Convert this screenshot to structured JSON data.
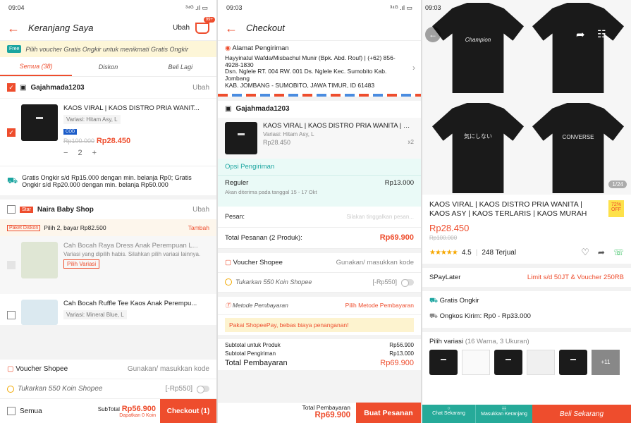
{
  "cart_screen": {
    "status_time": "09:04",
    "status_right": "³⁴ᴳ .ıl ▭",
    "title": "Keranjang Saya",
    "edit": "Ubah",
    "cart_badge": "99+",
    "notice": {
      "badge": "Free",
      "text": "Pilih voucher Gratis Ongkir untuk menikmati Gratis Ongkir"
    },
    "tabs": [
      "Semua (38)",
      "Diskon",
      "Beli Lagi"
    ],
    "shop1": {
      "name": "Gajahmada1203",
      "edit": "Ubah"
    },
    "item1": {
      "name": "KAOS VIRAL | KAOS DISTRO PRIA WANIT...",
      "variant": "Variasi: Hitam Asy, L",
      "tag": "COD",
      "old_price": "Rp100.000",
      "price": "Rp28.450",
      "minus": "−",
      "qty": "2",
      "plus": "+"
    },
    "shipping_note": "Gratis Ongkir s/d Rp15.000 dengan min. belanja Rp0; Gratis Ongkir s/d Rp20.000 dengan min. belanja Rp50.000",
    "shop2": {
      "badge": "Star",
      "name": "Naira Baby Shop",
      "edit": "Ubah"
    },
    "package": {
      "badge": "Paket Diskon",
      "text": "Pilih 2, bayar Rp82.500",
      "action": "Tambah"
    },
    "item2": {
      "name": "Cah Bocah Raya Dress Anak Perempuan L...",
      "note": "Variasi yang dipilih habis. Silahkan pilih variasi lainnya.",
      "button": "Pilih Variasi"
    },
    "item3": {
      "name": "Cah Bocah Ruffle Tee Kaos Anak Perempu...",
      "variant": "Variasi: Mineral Blue, L"
    },
    "voucher": {
      "label": "Voucher Shopee",
      "action": "Gunakan/ masukkan kode"
    },
    "coins": {
      "label": "Tukarkan 550 Koin Shopee",
      "value": "[-Rp550]"
    },
    "footer": {
      "all": "Semua",
      "subtotal_label": "SubTotal",
      "subtotal": "Rp56.900",
      "coins_earned": "Dapatkan 0 Koin",
      "checkout": "Checkout (1)"
    }
  },
  "checkout_screen": {
    "status_time": "09:03",
    "title": "Checkout",
    "address_label": "Alamat Pengiriman",
    "address_lines": [
      "Hayyinatul Wafda/Misbachul Munir (Bpk. Abd. Rouf) | (+62) 856-4928-1830",
      "Dsn. Nglele RT. 004 RW. 001 Ds. Nglele Kec. Sumobito Kab. Jombang",
      "KAB. JOMBANG - SUMOBITO, JAWA TIMUR, ID 61483"
    ],
    "shop": "Gajahmada1203",
    "product": {
      "name": "KAOS VIRAL | KAOS DISTRO PRIA WANITA | KA...",
      "variant": "Variasi: Hitam Asy, L",
      "price": "Rp28.450",
      "qty": "x2"
    },
    "shipping_options": "Opsi Pengiriman",
    "regular": {
      "label": "Reguler",
      "price": "Rp13.000",
      "eta": "Akan diterima pada tanggal 15 - 17 Okt"
    },
    "message": {
      "label": "Pesan:",
      "placeholder": "Silakan tinggalkan pesan..."
    },
    "order_total": {
      "label": "Total Pesanan (2 Produk):",
      "value": "Rp69.900"
    },
    "voucher": {
      "label": "Voucher Shopee",
      "action": "Gunakan/ masukkan kode"
    },
    "coins": {
      "label": "Tukarkan 550 Koin Shopee",
      "value": "[-Rp550]"
    },
    "payment": {
      "label": "Metode Pembayaran",
      "action": "Pilih Metode Pembayaran"
    },
    "promo": "Pakai ShopeePay, bebas biaya penanganan!",
    "summary": [
      {
        "label": "Subtotal untuk Produk",
        "value": "Rp56.900"
      },
      {
        "label": "Subtotal Pengiriman",
        "value": "Rp13.000"
      }
    ],
    "grand_total": {
      "label": "Total Pembayaran",
      "value": "Rp69.900"
    },
    "footer": {
      "label": "Total Pembayaran",
      "value": "Rp69.900",
      "button": "Buat Pesanan"
    }
  },
  "product_screen": {
    "status_time": "09:03",
    "shirts": [
      "Champion",
      "",
      "気にしない",
      "CONVERSE"
    ],
    "image_counter": "1/24",
    "title": "KAOS VIRAL | KAOS DISTRO PRIA WANITA | KAOS ASY | KAOS TERLARIS | KAOS MURAH",
    "discount": "72% OFF",
    "price": "Rp28.450",
    "old_price": "Rp100.000",
    "stars": "★★★★★",
    "rating": "4.5",
    "sold": "248 Terjual",
    "paylater": {
      "label": "SPayLater",
      "value": "Limit s/d 50JT & Voucher 250RB"
    },
    "free_shipping": "Gratis Ongkir",
    "shipping_cost": "Ongkos Kirim: Rp0 - Rp33.000",
    "variants": {
      "label": "Pilih variasi",
      "count": "(16 Warna, 3 Ukuran)",
      "more": "+11"
    },
    "footer": {
      "chat": "Chat Sekarang",
      "add_cart": "Masukkan Keranjang",
      "buy": "Beli Sekarang"
    }
  }
}
